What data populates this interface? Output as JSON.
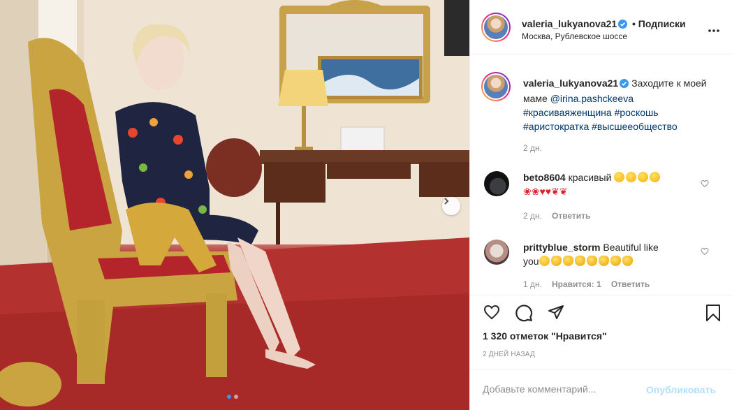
{
  "post": {
    "username": "valeria_lukyanova21",
    "follow_label": "• Подписки",
    "location": "Москва, Рублевское шоссе"
  },
  "caption": {
    "username": "valeria_lukyanova21",
    "text": "Заходите к моей маме",
    "mention": "@irina.pashckeeva",
    "hashtags_line1": "#красиваяженщина #роскошь",
    "hashtags_line2": "#аристократка #высшееобщество",
    "time": "2 дн."
  },
  "comments": [
    {
      "username": "beto8604",
      "text": "красивый",
      "emoji_line1": [
        "face-blowing-kiss",
        "face-blowing-kiss",
        "heart-eyes",
        "heart-eyes"
      ],
      "emoji_line2": [
        "rose",
        "rose",
        "red-heart",
        "red-heart",
        "kiss-lips",
        "kiss-lips"
      ],
      "time": "2 дн.",
      "reply_label": "Ответить"
    },
    {
      "username": "prittyblue_storm",
      "text_line1": "Beautiful like",
      "text_line2": "you",
      "emoji": [
        "heart-eyes",
        "clap",
        "clap",
        "clap",
        "clap",
        "clap",
        "clap",
        "clap"
      ],
      "time": "1 дн.",
      "likes_label": "Нравится: 1",
      "reply_label": "Ответить"
    }
  ],
  "likes_text": "1 320 отметок \"Нравится\"",
  "date_text": "2 ДНЕЙ НАЗАД",
  "comment_box": {
    "placeholder": "Добавьте комментарий...",
    "publish_label": "Опубликовать"
  },
  "carousel": {
    "current": 1,
    "total": 2
  },
  "colors": {
    "accent": "#3897f0",
    "publish_disabled": "#b2dffc",
    "tag": "#00376b",
    "muted": "#8e8e8e"
  }
}
